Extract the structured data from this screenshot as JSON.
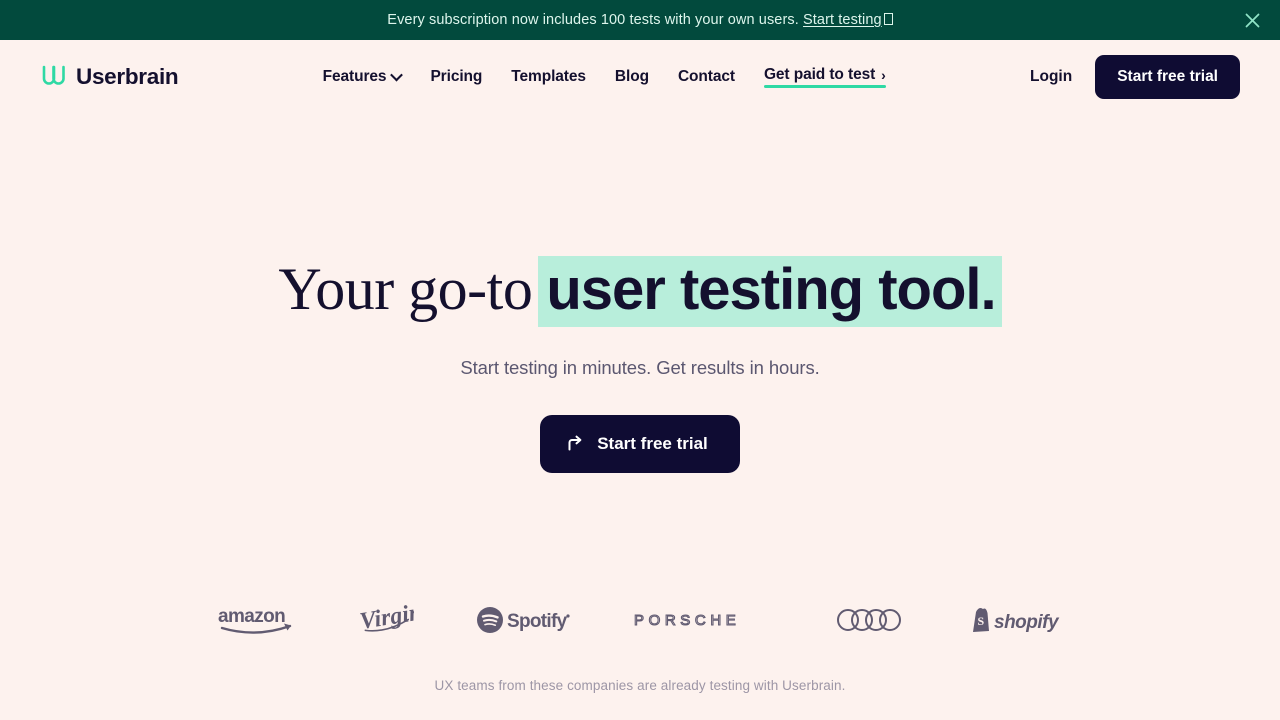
{
  "banner": {
    "text": "Every subscription now includes 100 tests with your own users.",
    "link_label": "Start testing",
    "glyph": " ",
    "close_icon": "close-icon",
    "background_color": "#024a3d",
    "text_color": "#ddf5ec"
  },
  "header": {
    "brand_name": "Userbrain",
    "nav": [
      {
        "label": "Features",
        "has_dropdown": true
      },
      {
        "label": "Pricing",
        "has_dropdown": false
      },
      {
        "label": "Templates",
        "has_dropdown": false
      },
      {
        "label": "Blog",
        "has_dropdown": false
      },
      {
        "label": "Contact",
        "has_dropdown": false
      },
      {
        "label": "Get paid to test",
        "has_dropdown": false,
        "accent": true,
        "arrow": "›"
      }
    ],
    "login_label": "Login",
    "trial_label": "Start free trial"
  },
  "hero": {
    "title_plain": "Your go-to",
    "title_highlight": "user testing tool.",
    "subtitle": "Start testing in minutes. Get results in hours.",
    "cta_label": "Start free trial",
    "cta_icon": "arrow-turn-right-icon",
    "highlight_color": "#b8eedb"
  },
  "logos": {
    "items": [
      {
        "name": "amazon"
      },
      {
        "name": "virgin"
      },
      {
        "name": "spotify"
      },
      {
        "name": "porsche"
      },
      {
        "name": "audi"
      },
      {
        "name": "shopify"
      }
    ],
    "caption": "UX teams from these companies are already testing with Userbrain."
  },
  "colors": {
    "page_background": "#fdf2ee",
    "ink": "#14102e",
    "accent_mint": "#2fd9a4",
    "dark_button": "#0f0c33"
  }
}
